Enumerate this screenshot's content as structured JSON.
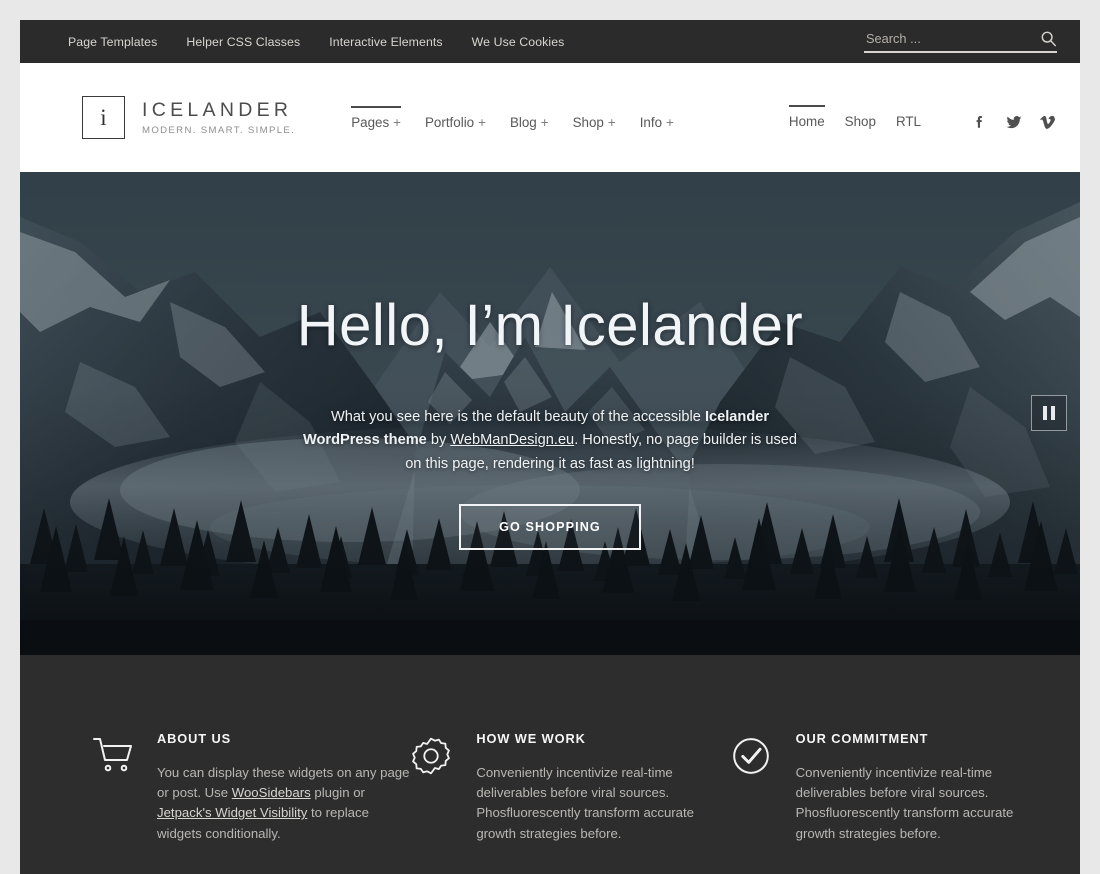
{
  "colors": {
    "page_background": "#e8e8e8",
    "topbar_background": "#2b2b2b",
    "widgets_background": "#2d2d2d",
    "header_background": "#ffffff",
    "accent_text": "#585858"
  },
  "topbar": {
    "menu": [
      {
        "label": "Page Templates"
      },
      {
        "label": "Helper CSS Classes"
      },
      {
        "label": "Interactive Elements"
      },
      {
        "label": "We Use Cookies"
      }
    ],
    "search": {
      "placeholder": "Search ...",
      "value": "",
      "icon": "search-icon"
    }
  },
  "header": {
    "logo": {
      "mark": "i",
      "title": "ICELANDER",
      "tagline": "MODERN. SMART. SIMPLE."
    },
    "main_menu": [
      {
        "label": "Pages",
        "suffix": "+",
        "active": true
      },
      {
        "label": "Portfolio",
        "suffix": "+",
        "active": false
      },
      {
        "label": "Blog",
        "suffix": "+",
        "active": false
      },
      {
        "label": "Shop",
        "suffix": "+",
        "active": false
      },
      {
        "label": "Info",
        "suffix": "+",
        "active": false
      }
    ],
    "secondary_menu": [
      {
        "label": "Home",
        "active": true
      },
      {
        "label": "Shop",
        "active": false
      },
      {
        "label": "RTL",
        "active": false
      }
    ],
    "social": [
      {
        "name": "facebook-icon",
        "glyph": "f"
      },
      {
        "name": "twitter-icon",
        "glyph": "t"
      },
      {
        "name": "vimeo-icon",
        "glyph": "v"
      }
    ]
  },
  "hero": {
    "title": "Hello, I’m Icelander",
    "text_part_1": "What you see here is the default beauty of the accessible ",
    "text_bold_1": "Icelander WordPress theme",
    "text_part_2": " by ",
    "text_link": "WebManDesign.eu",
    "text_part_3": ". Honestly, no page builder is used on this page, rendering it as fast as lightning!",
    "button_label": "GO SHOPPING",
    "pause_control": "pause-icon"
  },
  "widgets": [
    {
      "icon": "shopping-cart-icon",
      "title": "ABOUT US",
      "text_part_1": "You can display these widgets on any page or post. Use ",
      "link_1": "WooSidebars",
      "text_part_2": " plugin or ",
      "link_2": "Jetpack's Widget Visibility",
      "text_part_3": " to replace widgets conditionally."
    },
    {
      "icon": "gear-icon",
      "title": "HOW WE WORK",
      "text": "Conveniently incentivize real-time deliverables before viral sources. Phosfluorescently transform accurate growth strategies before."
    },
    {
      "icon": "check-circle-icon",
      "title": "OUR COMMITMENT",
      "text": "Conveniently incentivize real-time deliverables before viral sources. Phosfluorescently transform accurate growth strategies before."
    }
  ]
}
